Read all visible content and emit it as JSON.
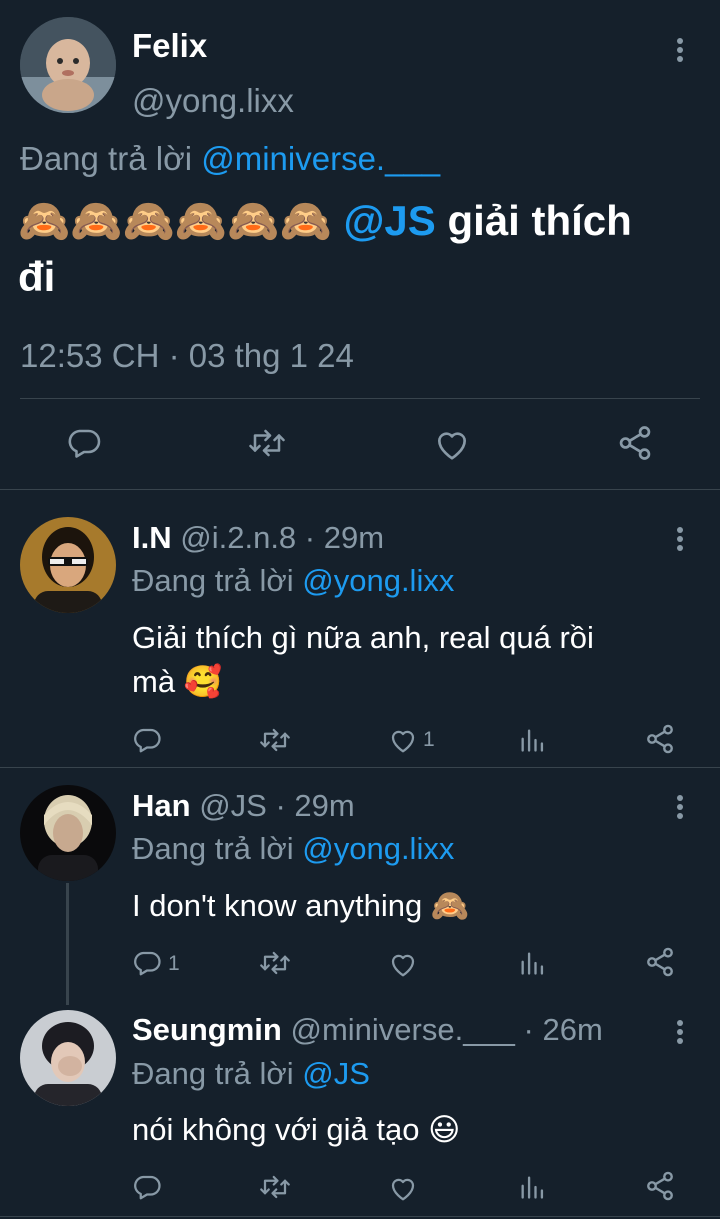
{
  "main_tweet": {
    "name": "Felix",
    "handle": "@yong.lixx",
    "replying_prefix": "Đang trả lời",
    "replying_to": "@miniverse.___",
    "emojis": "🙈🙈🙈🙈🙈🙈",
    "mention": "@JS",
    "text_after_mention": "giải thích",
    "text_line2": "đi",
    "timestamp": "12:53 CH · 03 thg 1 24"
  },
  "replies": [
    {
      "name": "I.N",
      "handle": "@i.2.n.8",
      "time": "· 29m",
      "replying_prefix": "Đang trả lời",
      "replying_to": "@yong.lixx",
      "text_line1": "Giải thích gì nữa anh, real quá rồi",
      "text_line2": "mà",
      "emoji": "🥰",
      "reply_count": "",
      "like_count": "1"
    },
    {
      "name": "Han",
      "handle": "@JS",
      "time": "· 29m",
      "replying_prefix": "Đang trả lời",
      "replying_to": "@yong.lixx",
      "text_line1": "I don't know anything",
      "emoji": "🙈",
      "reply_count": "1",
      "like_count": ""
    },
    {
      "name": "Seungmin",
      "handle": "@miniverse.___",
      "time": "· 26m",
      "replying_prefix": "Đang trả lời",
      "replying_to": "@JS",
      "text_line1": "nói không với giả tạo",
      "emoji": "😃",
      "reply_count": "",
      "like_count": ""
    }
  ],
  "colors": {
    "background": "#15202b",
    "accent": "#1d9bf0",
    "muted": "#8899a6",
    "divider": "#38444d"
  },
  "icons": [
    "more-icon",
    "reply-icon",
    "retweet-icon",
    "like-icon",
    "share-icon",
    "views-icon"
  ]
}
